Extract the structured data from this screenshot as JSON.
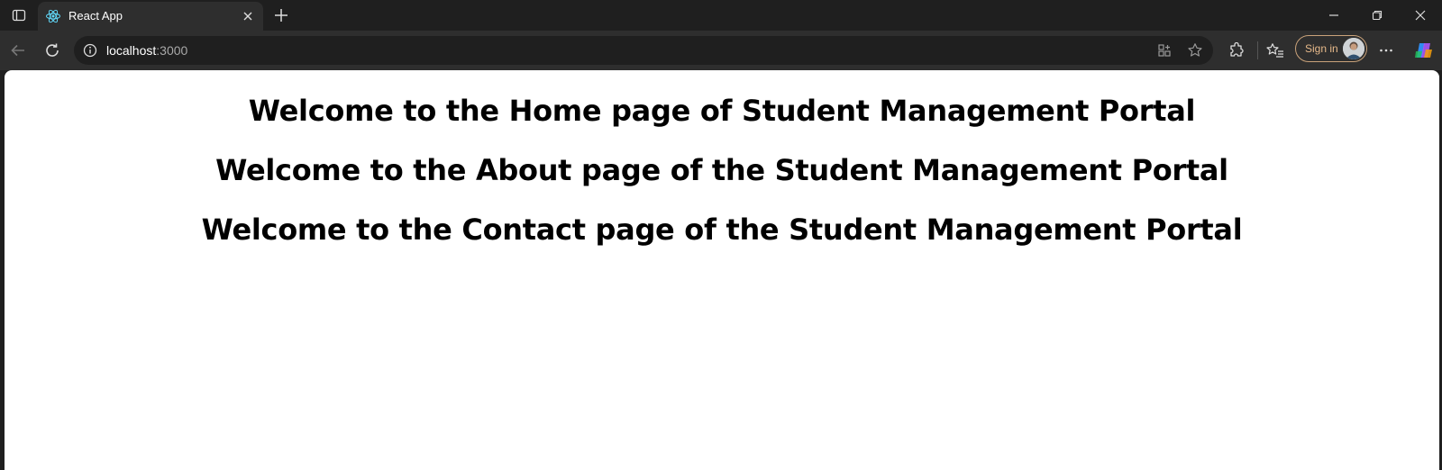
{
  "browser": {
    "tab": {
      "title": "React App"
    },
    "address": {
      "host": "localhost",
      "port": ":3000"
    },
    "signin_label": "Sign in",
    "colors": {
      "frame": "#1f1f1f",
      "toolbar": "#2e2e2e",
      "accent": "#e6b98a"
    }
  },
  "page": {
    "headings": [
      "Welcome to the Home page of Student Management Portal",
      "Welcome to the About page of the Student Management Portal",
      "Welcome to the Contact page of the Student Management Portal"
    ]
  }
}
